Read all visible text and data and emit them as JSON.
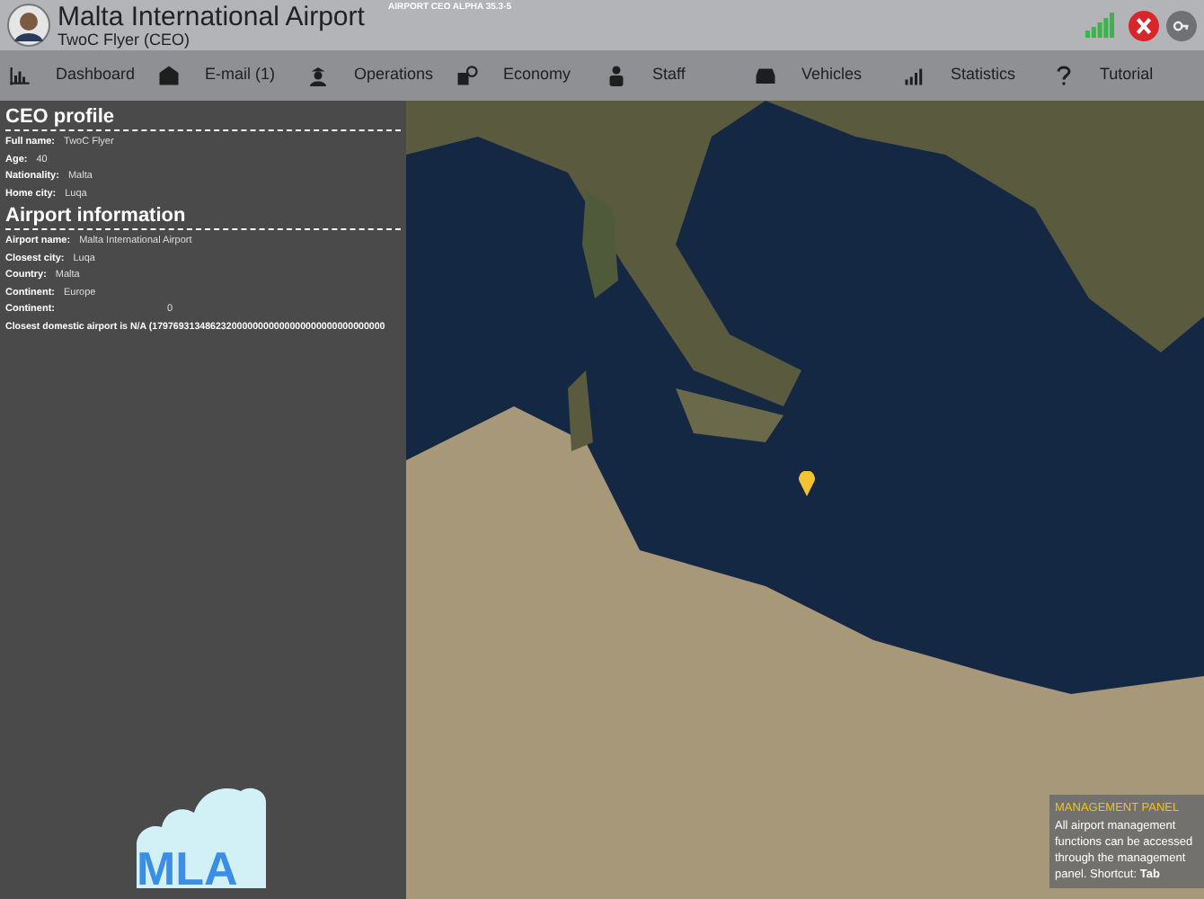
{
  "header": {
    "title": "Malta International Airport",
    "subtitle": "TwoC Flyer (CEO)",
    "version": "AIRPORT CEO ALPHA 35.3-5"
  },
  "nav": [
    {
      "label": "Dashboard"
    },
    {
      "label": "E-mail (1)"
    },
    {
      "label": "Operations"
    },
    {
      "label": "Economy"
    },
    {
      "label": "Staff"
    },
    {
      "label": "Vehicles"
    },
    {
      "label": "Statistics"
    },
    {
      "label": "Tutorial"
    }
  ],
  "sections": [
    {
      "title": "CEO profile",
      "rows": [
        {
          "label": "Full name:",
          "value": "TwoC Flyer"
        },
        {
          "label": "Age:",
          "value": "40"
        },
        {
          "label": "Nationality:",
          "value": "Malta"
        },
        {
          "label": "Home city:",
          "value": "Luqa"
        }
      ]
    },
    {
      "title": "Airport information",
      "rows": [
        {
          "label": "Airport name:",
          "value": "Malta International Airport"
        },
        {
          "label": "Closest city:",
          "value": "Luqa"
        },
        {
          "label": "Country:",
          "value": "Malta"
        },
        {
          "label": "Continent:",
          "value": "Europe"
        },
        {
          "label": "Continent:",
          "value": "0"
        }
      ],
      "note": "Closest domestic airport is N/A (17976931348623200000000000000000000000000000"
    }
  ],
  "logo": {
    "code": "MLA"
  },
  "tip": {
    "title": "MANAGEMENT PANEL",
    "text": "All airport management functions can be accessed through the management panel. Shortcut: **Tab**"
  }
}
